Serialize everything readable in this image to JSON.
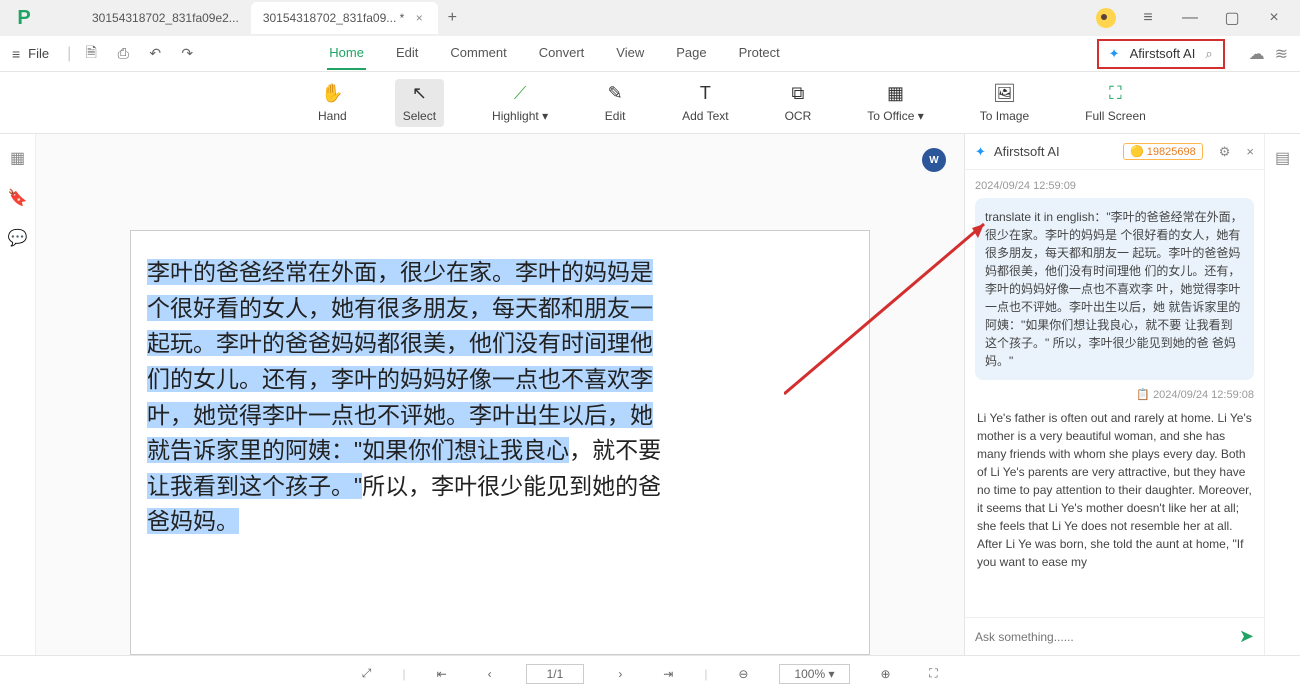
{
  "titlebar": {
    "tab1": "30154318702_831fa09e2...",
    "tab2": "30154318702_831fa09... *"
  },
  "menubar": {
    "file": "File",
    "tabs": [
      "Home",
      "Edit",
      "Comment",
      "Convert",
      "View",
      "Page",
      "Protect"
    ],
    "ai_label": "Afirstsoft AI"
  },
  "toolbar": {
    "hand": "Hand",
    "select": "Select",
    "highlight": "Highlight",
    "edit": "Edit",
    "addtext": "Add Text",
    "ocr": "OCR",
    "tooffice": "To Office",
    "toimage": "To Image",
    "fullscreen": "Full Screen"
  },
  "document": {
    "line1": "李叶的爸爸经常在外面，很少在家。李叶的妈妈是",
    "line2": "个很好看的女人，她有很多朋友，每天都和朋友一",
    "line3": "起玩。李叶的爸爸妈妈都很美，他们没有时间理他",
    "line4": "们的女儿。还有，李叶的妈妈好像一点也不喜欢李",
    "line5": "叶，她觉得李叶一点也不评她。李叶出生以后，她",
    "line6a": "就告诉家里的阿姨：\"如果你们想让我良心",
    "line6b": "，就不要",
    "line7a": "让我看到这个孩子。\"",
    "line7b": "所以，李叶很少能见到她的爸",
    "line8": "爸妈妈。"
  },
  "ai": {
    "title": "Afirstsoft AI",
    "badge": "19825698",
    "ts1": "2024/09/24 12:59:09",
    "prompt": "translate it in english：\"李叶的爸爸经常在外面，很少在家。李叶的妈妈是 个很好看的女人，她有很多朋友，每天都和朋友一 起玩。李叶的爸爸妈妈都很美，他们没有时间理他 们的女儿。还有，李叶的妈妈好像一点也不喜欢李 叶，她觉得李叶一点也不评她。李叶出生以后，她 就告诉家里的阿姨：\"如果你们想让我良心，就不要 让我看到这个孩子。\" 所以，李叶很少能见到她的爸 爸妈妈。\"",
    "ts2": "2024/09/24 12:59:08",
    "response": "Li Ye's father is often out and rarely at home. Li Ye's mother is a very beautiful woman, and she has many friends with whom she plays every day. Both of Li Ye's parents are very attractive, but they have no time to pay attention to their daughter. Moreover, it seems that Li Ye's mother doesn't like her at all; she feels that Li Ye does not resemble her at all. After Li Ye was born, she told the aunt at home, \"If you want to ease my",
    "placeholder": "Ask something......"
  },
  "status": {
    "page": "1/1",
    "zoom": "100%"
  }
}
